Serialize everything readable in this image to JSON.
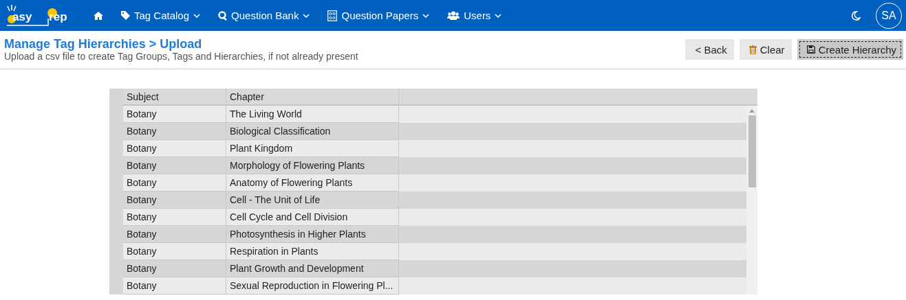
{
  "nav": {
    "logo_left": "asy",
    "logo_right": "rep",
    "items": [
      {
        "kind": "home"
      },
      {
        "kind": "tag",
        "label": "Tag Catalog"
      },
      {
        "kind": "q",
        "label": "Question Bank"
      },
      {
        "kind": "paper",
        "label": "Question Papers"
      },
      {
        "kind": "users",
        "label": "Users"
      }
    ],
    "avatar": "SA"
  },
  "header": {
    "title": "Manage Tag Hierarchies > Upload",
    "subtitle": "Upload a csv file to create Tag Groups, Tags and Hierarchies, if not already present",
    "buttons": [
      {
        "kind": "back",
        "label": "< Back",
        "focused": false
      },
      {
        "kind": "clear",
        "label": "Clear",
        "focused": false
      },
      {
        "kind": "save",
        "label": "Create Hierarchy",
        "focused": true
      }
    ]
  },
  "table": {
    "columns": [
      "Subject",
      "Chapter"
    ],
    "rows": [
      [
        "Botany",
        "The Living World"
      ],
      [
        "Botany",
        "Biological Classification"
      ],
      [
        "Botany",
        "Plant Kingdom"
      ],
      [
        "Botany",
        "Morphology of Flowering Plants"
      ],
      [
        "Botany",
        "Anatomy of Flowering Plants"
      ],
      [
        "Botany",
        "Cell - The Unit of Life"
      ],
      [
        "Botany",
        "Cell Cycle and Cell Division"
      ],
      [
        "Botany",
        "Photosynthesis in Higher Plants"
      ],
      [
        "Botany",
        "Respiration in Plants"
      ],
      [
        "Botany",
        "Plant Growth and Development"
      ],
      [
        "Botany",
        "Sexual Reproduction in Flowering Pl..."
      ]
    ]
  }
}
